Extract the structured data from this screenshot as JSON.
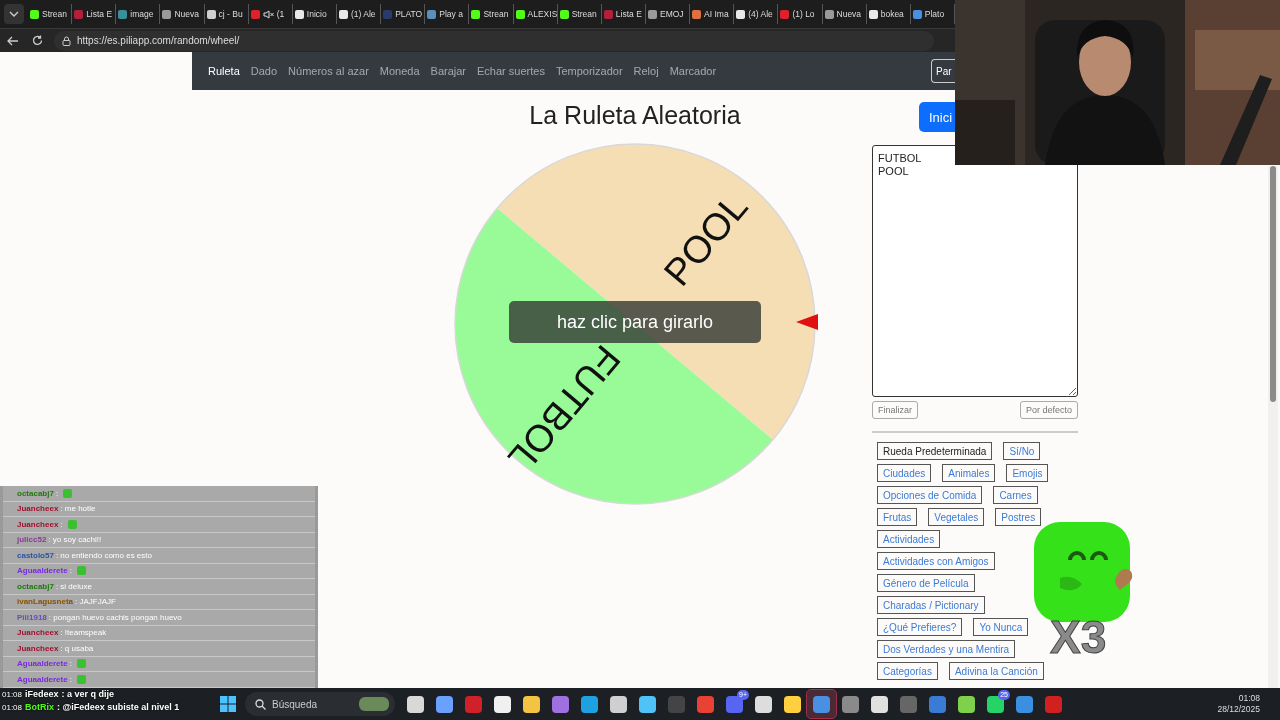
{
  "browser": {
    "tabs": [
      {
        "label": "Strean",
        "color": "#53fc18",
        "muted": false
      },
      {
        "label": "Lista E",
        "color": "#b0203a",
        "muted": false
      },
      {
        "label": "image",
        "color": "#3a8f9a",
        "muted": false
      },
      {
        "label": "Nueva",
        "color": "#9a9a9a",
        "muted": false
      },
      {
        "label": "cj - Bu",
        "color": "#cfcfcf",
        "muted": false
      },
      {
        "label": "(1",
        "color": "#e0202a",
        "muted": true
      },
      {
        "label": "Inicio",
        "color": "#e8e8e8",
        "muted": false
      },
      {
        "label": "(1) Ale",
        "color": "#e8e8e8",
        "muted": false
      },
      {
        "label": "PLATO",
        "color": "#2a3a6a",
        "muted": false
      },
      {
        "label": "Play a",
        "color": "#5a8fc0",
        "muted": false
      },
      {
        "label": "Strean",
        "color": "#53fc18",
        "muted": false
      },
      {
        "label": "ALEXIS",
        "color": "#53fc18",
        "muted": false
      },
      {
        "label": "Strean",
        "color": "#53fc18",
        "muted": false
      },
      {
        "label": "Lista E",
        "color": "#b0203a",
        "muted": false
      },
      {
        "label": "EMOJ",
        "color": "#9a9a9a",
        "muted": false
      },
      {
        "label": "AI Ima",
        "color": "#e07040",
        "muted": false
      },
      {
        "label": "(4) Ale",
        "color": "#e8e8e8",
        "muted": false
      },
      {
        "label": "(1) Lo",
        "color": "#e0202a",
        "muted": false
      },
      {
        "label": "Nueva",
        "color": "#9a9a9a",
        "muted": false
      },
      {
        "label": "bokea",
        "color": "#e8e8e8",
        "muted": false
      },
      {
        "label": "Plato",
        "color": "#4a90e2",
        "muted": false
      }
    ],
    "url": "https://es.piliapp.com/random/wheel/"
  },
  "nav": {
    "links": [
      {
        "label": "Ruleta",
        "selected": true
      },
      {
        "label": "Dado",
        "selected": false
      },
      {
        "label": "Números al azar",
        "selected": false
      },
      {
        "label": "Moneda",
        "selected": false
      },
      {
        "label": "Barajar",
        "selected": false
      },
      {
        "label": "Echar suertes",
        "selected": false
      },
      {
        "label": "Temporizador",
        "selected": false
      },
      {
        "label": "Reloj",
        "selected": false
      },
      {
        "label": "Marcador",
        "selected": false
      }
    ],
    "button": "Par"
  },
  "title": "La Ruleta Aleatoria",
  "wheel": {
    "segments": [
      {
        "label": "POOL",
        "color": "#f5deb3"
      },
      {
        "label": "FUTBOL",
        "color": "#98fb98"
      }
    ],
    "hint": "haz clic para girarlo"
  },
  "panel": {
    "start_button": "Inici",
    "entries": [
      "FUTBOL",
      "POOL"
    ],
    "finish_button": "Finalizar",
    "default_button": "Por defecto",
    "presets": [
      {
        "label": "Rueda Predeterminada",
        "selected": true
      },
      {
        "label": "Sí/No",
        "selected": false
      },
      {
        "label": "Ciudades",
        "selected": false
      },
      {
        "label": "Animales",
        "selected": false
      },
      {
        "label": "Emojis",
        "selected": false
      },
      {
        "label": "Opciones de Comida",
        "selected": false
      },
      {
        "label": "Carnes",
        "selected": false
      },
      {
        "label": "Frutas",
        "selected": false
      },
      {
        "label": "Vegetales",
        "selected": false
      },
      {
        "label": "Postres",
        "selected": false
      },
      {
        "label": "Actividades",
        "selected": false
      },
      {
        "label": "Actividades con Amigos",
        "selected": false
      },
      {
        "label": "Género de Película",
        "selected": false
      },
      {
        "label": "Charadas / Pictionary",
        "selected": false
      },
      {
        "label": "¿Qué Prefieres?",
        "selected": false
      },
      {
        "label": "Yo Nunca",
        "selected": false
      },
      {
        "label": "Dos Verdades y una Mentira",
        "selected": false
      },
      {
        "label": "Categorías",
        "selected": false
      },
      {
        "label": "Adivina la Canción",
        "selected": false
      }
    ]
  },
  "chat": {
    "messages": [
      {
        "name": "octacabj7",
        "color": "#1f7a0a",
        "text": ":",
        "kind": "emote"
      },
      {
        "name": "Juancheex",
        "color": "#a01030",
        "text": ": me hotle",
        "kind": "text"
      },
      {
        "name": "Juancheex",
        "color": "#a01030",
        "text": ":",
        "kind": "emote"
      },
      {
        "name": "julicc52",
        "color": "#8a3a98",
        "text": ": yo soy cachi!!",
        "kind": "text"
      },
      {
        "name": "castolo57",
        "color": "#2a55a8",
        "text": ": no entiendo como es esto",
        "kind": "text"
      },
      {
        "name": "Aguaalderete",
        "color": "#7a2ae0",
        "text": ":",
        "kind": "emote"
      },
      {
        "name": "octacabj7",
        "color": "#1f7a0a",
        "text": ": si deluxe",
        "kind": "text"
      },
      {
        "name": "ivanLagusneta",
        "color": "#8a5000",
        "text": ": JAJFJAJF",
        "kind": "text"
      },
      {
        "name": "Pili1918",
        "color": "#6a4ac0",
        "text": ": pongan huevo cachis pongan huevo",
        "kind": "text"
      },
      {
        "name": "Juancheex",
        "color": "#a01030",
        "text": ": !teamspeak",
        "kind": "text"
      },
      {
        "name": "Juancheex",
        "color": "#a01030",
        "text": ": q usaba",
        "kind": "text"
      },
      {
        "name": "Aguaalderete",
        "color": "#7a2ae0",
        "text": ":",
        "kind": "emote"
      },
      {
        "name": "Aguaalderete",
        "color": "#7a2ae0",
        "text": ":",
        "kind": "emote"
      }
    ],
    "overlay": [
      {
        "time": "01:08",
        "name": "iFedeex",
        "color": "#ffffff",
        "text": ": a ver q dije"
      },
      {
        "time": "01:08",
        "name": "BotRix",
        "color": "#53fc18",
        "text": ": @iFedeex subiste al nivel 1"
      }
    ]
  },
  "sticker": {
    "caption": "X3"
  },
  "taskbar": {
    "search": "Búsqueda",
    "apps": [
      {
        "color": "#d8d8d8",
        "selected": false
      },
      {
        "color": "#6aa0ff",
        "selected": false
      },
      {
        "color": "#d0202a",
        "selected": false
      },
      {
        "color": "#f0f0f0",
        "selected": false
      },
      {
        "color": "#f5c342",
        "selected": false
      },
      {
        "color": "#a070e0",
        "selected": false
      },
      {
        "color": "#1fa0e0",
        "selected": false
      },
      {
        "color": "#cfcfcf",
        "selected": false
      },
      {
        "color": "#4fc3f7",
        "selected": false
      },
      {
        "color": "#444444",
        "selected": false
      },
      {
        "color": "#e94235",
        "selected": false
      },
      {
        "color": "#5865f2",
        "selected": false,
        "badge": "9+"
      },
      {
        "color": "#dddddd",
        "selected": false
      },
      {
        "color": "#ffcf3f",
        "selected": false
      },
      {
        "color": "#4a90e2",
        "selected": true
      },
      {
        "color": "#8a8a8a",
        "selected": false
      },
      {
        "color": "#e0e0e0",
        "selected": false
      },
      {
        "color": "#666666",
        "selected": false
      },
      {
        "color": "#3a7bd5",
        "selected": false
      },
      {
        "color": "#7fd04a",
        "selected": false
      },
      {
        "color": "#25d366",
        "selected": false,
        "badge": "25"
      },
      {
        "color": "#3a8fe0",
        "selected": false
      },
      {
        "color": "#d02020",
        "selected": false
      }
    ],
    "time": "01:08",
    "date": "28/12/2025"
  }
}
